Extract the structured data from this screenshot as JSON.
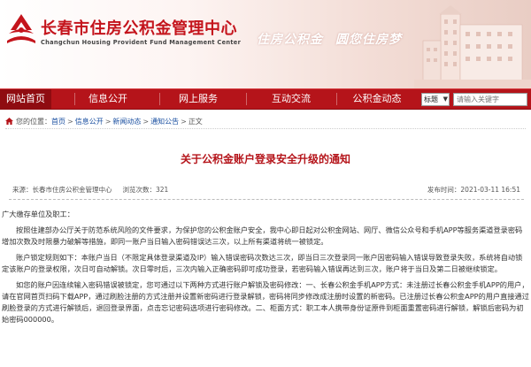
{
  "header": {
    "title": "长春市住房公积金管理中心",
    "subtitle": "Changchun Housing Provident Fund Management Center",
    "slogan_1": "住房公积金",
    "slogan_2": "圆您住房梦"
  },
  "nav": {
    "items": [
      "网站首页",
      "信息公开",
      "网上服务",
      "互动交流",
      "公积金动态"
    ],
    "search_scope": "标题",
    "search_placeholder": "请输入关键字"
  },
  "breadcrumb": {
    "prefix": "您的位置：",
    "items": [
      "首页",
      "信息公开",
      "新闻动态",
      "通知公告",
      "正文"
    ]
  },
  "article": {
    "title": "关于公积金账户登录安全升级的通知",
    "source_label": "来源：",
    "source": "长春市住房公积金管理中心",
    "views_label": "浏览次数：",
    "views": "321",
    "date_label": "发布时间：",
    "date": "2021-03-11 16:51",
    "greeting": "广大缴存单位及职工：",
    "paragraphs": [
      "按照住建部办公厅关于防范系统风险的文件要求，为保护您的公积金账户安全，我中心即日起对公积金网站、网厅、微信公众号和手机APP等服务渠道登录密码增加次数及时限暴力破解等措施，即同一账户当日输入密码错误达三次，以上所有渠道将统一被锁定。",
      "账户锁定规则如下：本账户当日（不限定具体登录渠道及IP）输入错误密码次数达三次，即当日三次登录同一账户因密码输入错误导致登录失败，系统将自动锁定该账户的登录权限，次日可自动解锁。次日零时后，三次内输入正确密码即可成功登录，若密码输入错误再达到三次，账户将于当日及第二日被继续锁定。",
      "如您的账户因连续输入密码错误被锁定，您可通过以下两种方式进行账户解锁及密码修改：一、长春公积金手机APP方式：未注册过长春公积金手机APP的用户，请在官网首页扫码下载APP，通过刷脸注册的方式注册并设置新密码进行登录解锁，密码将同步修改成注册时设置的新密码。已注册过长春公积金APP的用户直接通过刷脸登录的方式进行解锁后，退回登录界面，点击忘记密码选项进行密码修改。二、柜面方式：职工本人携带身份证原件到柜面重置密码进行解锁，解锁后密码为初始密码000000。"
    ]
  },
  "colors": {
    "brand_red": "#b5141a",
    "nav_active": "#8f0c11",
    "link_blue": "#1a4fa0"
  }
}
